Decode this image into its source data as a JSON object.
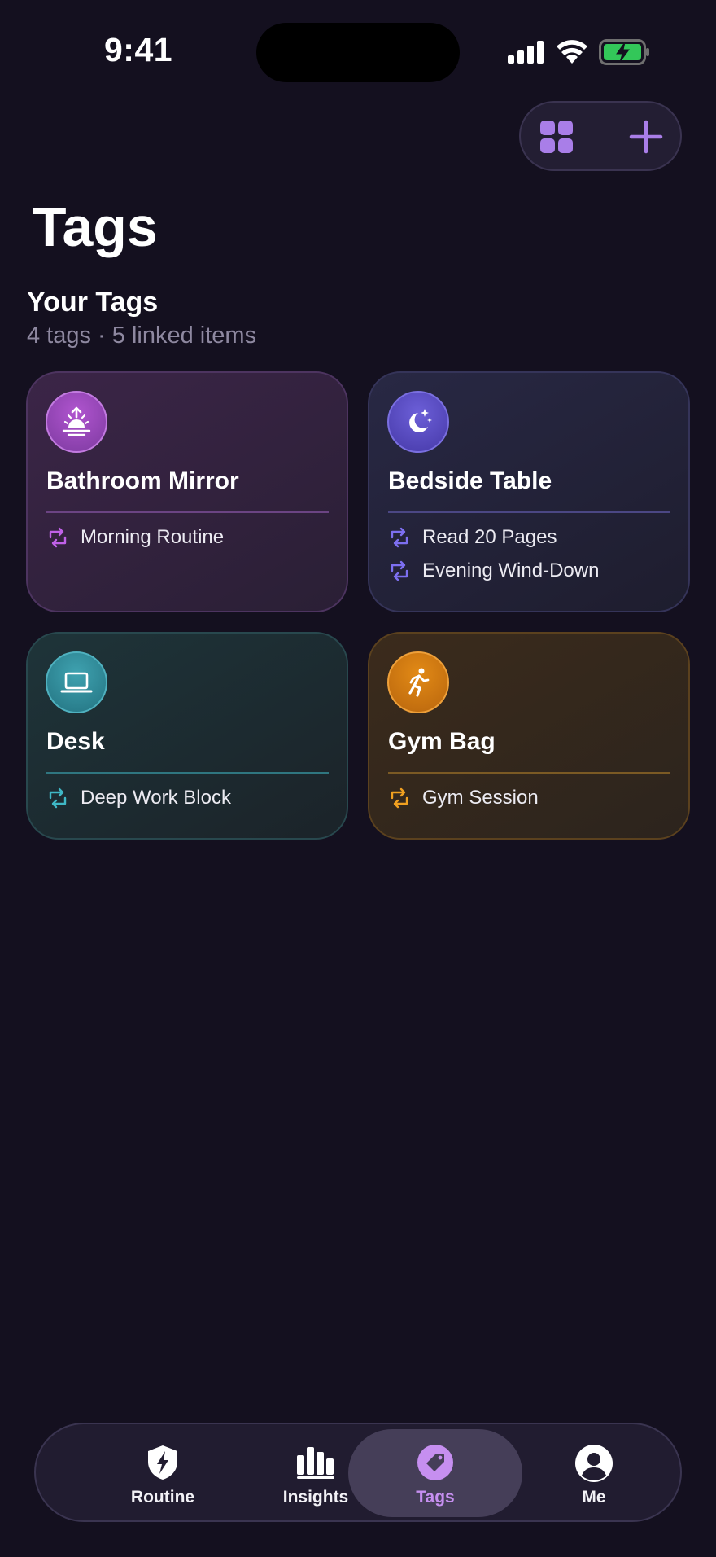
{
  "status_bar": {
    "time": "9:41"
  },
  "header": {
    "title": "Tags"
  },
  "section": {
    "title": "Your Tags",
    "subtitle": "4 tags · 5 linked items"
  },
  "colors": {
    "background": "#14101f",
    "accent": "#a97ee8",
    "purple": "#b055cf",
    "indigo": "#6c5fd8",
    "teal": "#3fa2b0",
    "amber": "#e28a16"
  },
  "tags": [
    {
      "name": "Bathroom Mirror",
      "icon": "sunrise-icon",
      "items": [
        "Morning Routine"
      ]
    },
    {
      "name": "Bedside Table",
      "icon": "moon-stars-icon",
      "items": [
        "Read 20 Pages",
        "Evening Wind-Down"
      ]
    },
    {
      "name": "Desk",
      "icon": "laptop-icon",
      "items": [
        "Deep Work Block"
      ]
    },
    {
      "name": "Gym Bag",
      "icon": "running-figure-icon",
      "items": [
        "Gym Session"
      ]
    }
  ],
  "tabbar": {
    "items": [
      {
        "label": "Routine",
        "icon": "shield-bolt-icon"
      },
      {
        "label": "Insights",
        "icon": "bar-chart-icon"
      },
      {
        "label": "Tags",
        "icon": "tag-icon",
        "active": true
      },
      {
        "label": "Me",
        "icon": "person-circle-icon"
      }
    ]
  }
}
